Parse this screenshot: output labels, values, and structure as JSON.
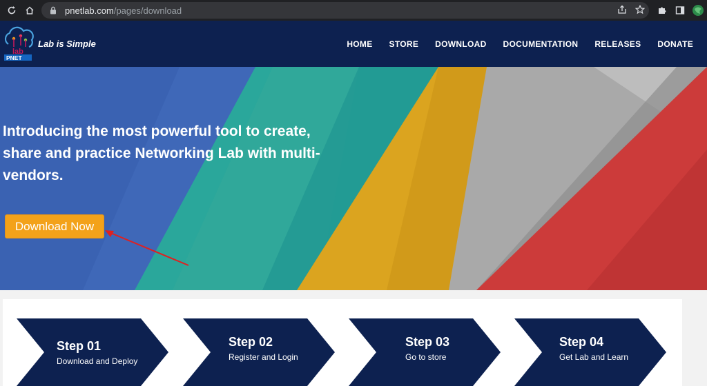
{
  "browser": {
    "url_host": "pnetlab.com",
    "url_path": "/pages/download",
    "icons": [
      "reload-icon",
      "home-icon",
      "lock-icon",
      "share-icon",
      "star-icon",
      "extensions-icon",
      "sidebar-icon",
      "profile-icon"
    ]
  },
  "header": {
    "tagline": "Lab is Simple",
    "logo_text": "PNET",
    "logo_mark": "lab",
    "nav": [
      "HOME",
      "STORE",
      "DOWNLOAD",
      "DOCUMENTATION",
      "RELEASES",
      "DONATE"
    ]
  },
  "hero": {
    "title": "Introducing the most powerful tool to create, share and practice Networking Lab with multi-vendors.",
    "cta_label": "Download Now",
    "colors": {
      "blue": "#3f68b8",
      "teal": "#2aa79b",
      "yellow": "#dba41f",
      "gray": "#a9a9a9",
      "red": "#cc3b3a",
      "cta": "#f3a21a"
    }
  },
  "steps": [
    {
      "title": "Step 01",
      "desc": "Download and Deploy"
    },
    {
      "title": "Step 02",
      "desc": "Register and Login"
    },
    {
      "title": "Step 03",
      "desc": "Go to store"
    },
    {
      "title": "Step 04",
      "desc": "Get Lab and Learn"
    }
  ],
  "step_color": "#0d2150"
}
